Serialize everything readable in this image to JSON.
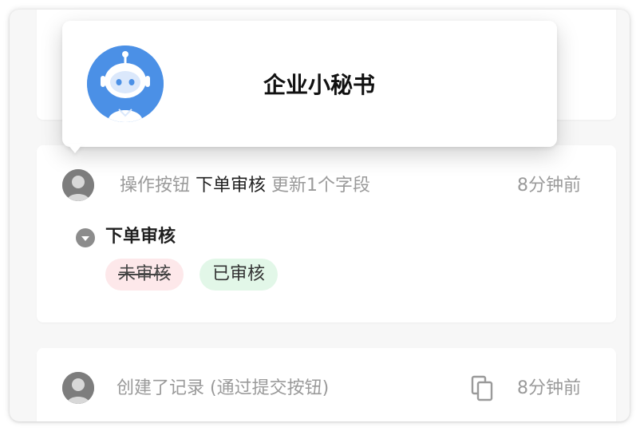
{
  "popover": {
    "bot_name": "企业小秘书",
    "avatar_color": "#4b90e6"
  },
  "activity": [
    {
      "action_prefix": "操作按钮",
      "action_target": "下单审核",
      "action_suffix": "更新1个字段",
      "time": "8分钟前",
      "field": {
        "name": "下单审核",
        "old_value": "未审核",
        "new_value": "已审核"
      }
    },
    {
      "action_text": "创建了记录 (通过提交按钮)",
      "time": "8分钟前"
    }
  ],
  "colors": {
    "old_tag_bg": "#fde8ea",
    "new_tag_bg": "#e2f7e8",
    "muted_text": "#9a9a9a"
  }
}
